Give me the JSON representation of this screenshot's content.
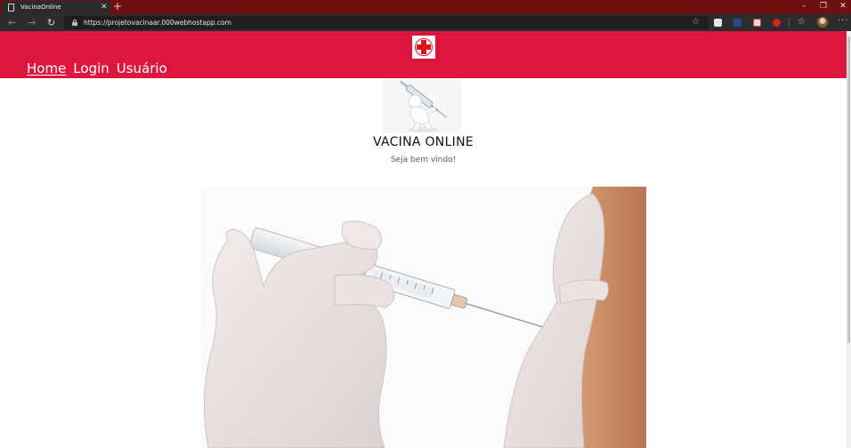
{
  "browser": {
    "tab_title": "VacinaOnline",
    "tab_close": "✕",
    "new_tab": "+",
    "url": "https://projetovacinaar.000webhostapp.com",
    "window_controls": {
      "minimize": "–",
      "restore": "❐",
      "close": "✕"
    },
    "nav_icons": [
      "back-arrow-icon",
      "forward-arrow-icon",
      "refresh-icon"
    ],
    "toolbar_icons": [
      "favorite-star-icon",
      "extension-icon",
      "extension-icon",
      "extension-icon",
      "extension-icon",
      "favorites-icon",
      "profile-avatar",
      "more-menu-icon"
    ],
    "colors": {
      "frame": "#6f0f11",
      "toolbar": "#2c2c2c"
    }
  },
  "site": {
    "nav": {
      "home": "Home",
      "login": "Login",
      "user": "Usuário"
    },
    "title": "VACINA ONLINE",
    "subtitle": "Seja bem vindo!",
    "colors": {
      "header": "#dc163c",
      "logo_cross": "#d9161f"
    }
  }
}
